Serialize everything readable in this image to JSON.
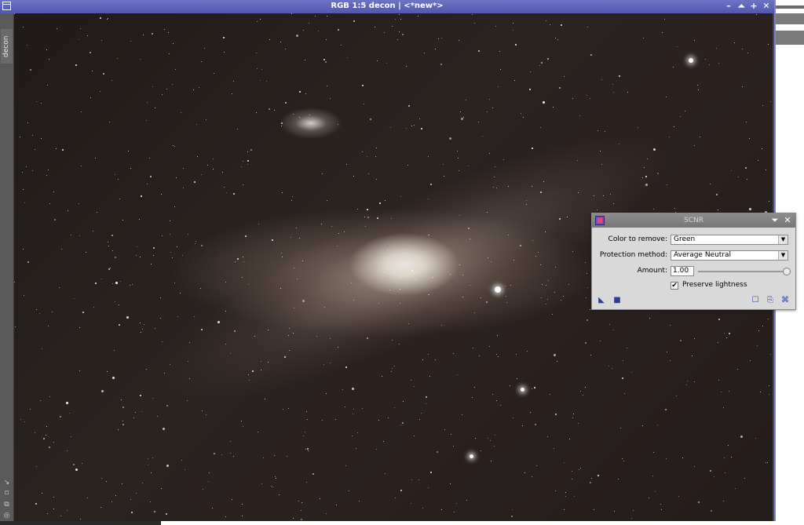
{
  "window": {
    "title": "RGB 1:5 decon | <*new*>",
    "side_tab": "decon",
    "buttons": {
      "minimize": "–",
      "shade": "⏶",
      "maximize": "+",
      "close": "✕"
    }
  },
  "side_icons": [
    "resize-icon",
    "fit-icon",
    "clone-icon",
    "target-icon"
  ],
  "scnr": {
    "title": "SCNR",
    "color_to_remove_label": "Color to remove:",
    "color_to_remove_value": "Green",
    "protection_label": "Protection method:",
    "protection_value": "Average Neutral",
    "amount_label": "Amount:",
    "amount_value": "1.00",
    "amount_fraction": 1.0,
    "preserve_lightness_label": "Preserve lightness",
    "preserve_lightness_checked": true
  },
  "colors": {
    "titlebar": "#5a61b8",
    "dialog_bg": "#d9d9d9",
    "icon_blue": "#2b3d9c"
  }
}
